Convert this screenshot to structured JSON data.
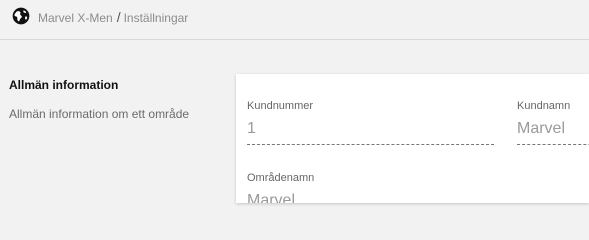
{
  "header": {
    "icon": "globe-icon",
    "breadcrumb": {
      "root": "Marvel X-Men",
      "separator": "/",
      "current": "Inställningar"
    }
  },
  "section": {
    "title": "Allmän information",
    "description": "Allmän information om ett område"
  },
  "form": {
    "customer_number": {
      "label": "Kundnummer",
      "value": "1"
    },
    "customer_name": {
      "label": "Kundnamn",
      "value": "Marvel"
    },
    "area_name": {
      "label": "Områdenamn",
      "value": "Marvel"
    }
  },
  "colors": {
    "background": "#f2f2f2",
    "card": "#ffffff",
    "muted_text": "#8c8c8c"
  }
}
